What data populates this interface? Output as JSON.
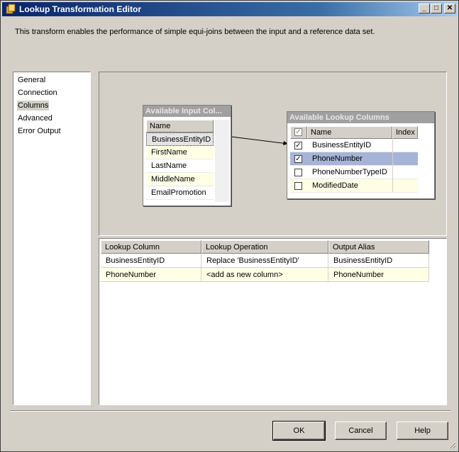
{
  "window": {
    "title": "Lookup Transformation Editor",
    "description": "This transform enables the performance of simple equi-joins between the input and a reference data set."
  },
  "nav": {
    "items": [
      "General",
      "Connection",
      "Columns",
      "Advanced",
      "Error Output"
    ],
    "selected": "Columns"
  },
  "input_table": {
    "title": "Available Input Col...",
    "header": "Name",
    "rows": [
      "BusinessEntityID",
      "FirstName",
      "LastName",
      "MiddleName",
      "EmailPromotion"
    ]
  },
  "lookup_table": {
    "title": "Available Lookup Columns",
    "headers": {
      "name": "Name",
      "index": "Index"
    },
    "rows": [
      {
        "name": "BusinessEntityID",
        "checked": true
      },
      {
        "name": "PhoneNumber",
        "checked": true
      },
      {
        "name": "PhoneNumberTypeID",
        "checked": false
      },
      {
        "name": "ModifiedDate",
        "checked": false
      }
    ]
  },
  "mapping_grid": {
    "headers": [
      "Lookup Column",
      "Lookup Operation",
      "Output Alias"
    ],
    "rows": [
      [
        "BusinessEntityID",
        "Replace 'BusinessEntityID'",
        "BusinessEntityID"
      ],
      [
        "PhoneNumber",
        "<add as new column>",
        "PhoneNumber"
      ]
    ]
  },
  "buttons": {
    "ok": "OK",
    "cancel": "Cancel",
    "help": "Help"
  },
  "title_buttons": {
    "minimize": "_",
    "maximize": "□",
    "close": "✕"
  },
  "colors": {
    "titlebar": "#0a246a",
    "face": "#d4d0c8",
    "row_highlight": "#ffffe6",
    "selected_row": "#a6b4d8"
  }
}
